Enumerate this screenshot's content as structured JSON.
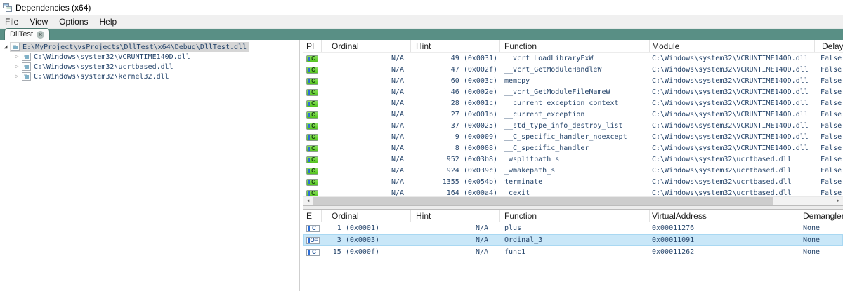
{
  "window": {
    "title": "Dependencies (x64)"
  },
  "menu": {
    "items": [
      {
        "label": "File"
      },
      {
        "label": "View"
      },
      {
        "label": "Options"
      },
      {
        "label": "Help"
      }
    ]
  },
  "tab": {
    "label": "DllTest",
    "close_glyph": "×"
  },
  "tree": {
    "expanded_glyph": "◢",
    "collapsed_glyph": "▷",
    "root": {
      "path": "E:\\MyProject\\vsProjects\\DllTest\\x64\\Debug\\DllTest.dll"
    },
    "children": [
      {
        "path": "C:\\Windows\\system32\\VCRUNTIME140D.dll"
      },
      {
        "path": "C:\\Windows\\system32\\ucrtbased.dll"
      },
      {
        "path": "C:\\Windows\\system32\\kernel32.dll"
      }
    ]
  },
  "imports": {
    "columns": [
      "PI",
      "Ordinal",
      "Hint",
      "Function",
      "Module",
      "Delaye"
    ],
    "icon_glyph": "C",
    "rows": [
      {
        "ordinal": "N/A",
        "hint": "49 (0x0031)",
        "function": "__vcrt_LoadLibraryExW",
        "module": "C:\\Windows\\system32\\VCRUNTIME140D.dll",
        "delayed": "False"
      },
      {
        "ordinal": "N/A",
        "hint": "47 (0x002f)",
        "function": "__vcrt_GetModuleHandleW",
        "module": "C:\\Windows\\system32\\VCRUNTIME140D.dll",
        "delayed": "False"
      },
      {
        "ordinal": "N/A",
        "hint": "60 (0x003c)",
        "function": "memcpy",
        "module": "C:\\Windows\\system32\\VCRUNTIME140D.dll",
        "delayed": "False"
      },
      {
        "ordinal": "N/A",
        "hint": "46 (0x002e)",
        "function": "__vcrt_GetModuleFileNameW",
        "module": "C:\\Windows\\system32\\VCRUNTIME140D.dll",
        "delayed": "False"
      },
      {
        "ordinal": "N/A",
        "hint": "28 (0x001c)",
        "function": "__current_exception_context",
        "module": "C:\\Windows\\system32\\VCRUNTIME140D.dll",
        "delayed": "False"
      },
      {
        "ordinal": "N/A",
        "hint": "27 (0x001b)",
        "function": "__current_exception",
        "module": "C:\\Windows\\system32\\VCRUNTIME140D.dll",
        "delayed": "False"
      },
      {
        "ordinal": "N/A",
        "hint": "37 (0x0025)",
        "function": "__std_type_info_destroy_list",
        "module": "C:\\Windows\\system32\\VCRUNTIME140D.dll",
        "delayed": "False"
      },
      {
        "ordinal": "N/A",
        "hint": "9 (0x0009)",
        "function": "__C_specific_handler_noexcept",
        "module": "C:\\Windows\\system32\\VCRUNTIME140D.dll",
        "delayed": "False"
      },
      {
        "ordinal": "N/A",
        "hint": "8 (0x0008)",
        "function": "__C_specific_handler",
        "module": "C:\\Windows\\system32\\VCRUNTIME140D.dll",
        "delayed": "False"
      },
      {
        "ordinal": "N/A",
        "hint": "952 (0x03b8)",
        "function": "_wsplitpath_s",
        "module": "C:\\Windows\\system32\\ucrtbased.dll",
        "delayed": "False"
      },
      {
        "ordinal": "N/A",
        "hint": "924 (0x039c)",
        "function": "_wmakepath_s",
        "module": "C:\\Windows\\system32\\ucrtbased.dll",
        "delayed": "False"
      },
      {
        "ordinal": "N/A",
        "hint": "1355 (0x054b)",
        "function": "terminate",
        "module": "C:\\Windows\\system32\\ucrtbased.dll",
        "delayed": "False"
      },
      {
        "ordinal": "N/A",
        "hint": "164 (0x00a4)",
        "function": "_cexit",
        "module": "C:\\Windows\\system32\\ucrtbased.dll",
        "delayed": "False"
      }
    ],
    "scrollbar": {
      "left_glyph": "◄",
      "right_glyph": "►"
    }
  },
  "exports": {
    "columns": [
      "E",
      "Ordinal",
      "Hint",
      "Function",
      "VirtualAddress",
      "Demangler"
    ],
    "rows": [
      {
        "icon_glyph": "C",
        "ordinal": "1 (0x0001)",
        "hint": "N/A",
        "function": "plus",
        "virtual_address": "0x00011276",
        "demangler": "None",
        "selected": false
      },
      {
        "icon_glyph": "O≡",
        "ordinal": "3 (0x0003)",
        "hint": "N/A",
        "function": "Ordinal_3",
        "virtual_address": "0x00011091",
        "demangler": "None",
        "selected": true
      },
      {
        "icon_glyph": "C",
        "ordinal": "15 (0x000f)",
        "hint": "N/A",
        "function": "func1",
        "virtual_address": "0x00011262",
        "demangler": "None",
        "selected": false
      }
    ]
  }
}
